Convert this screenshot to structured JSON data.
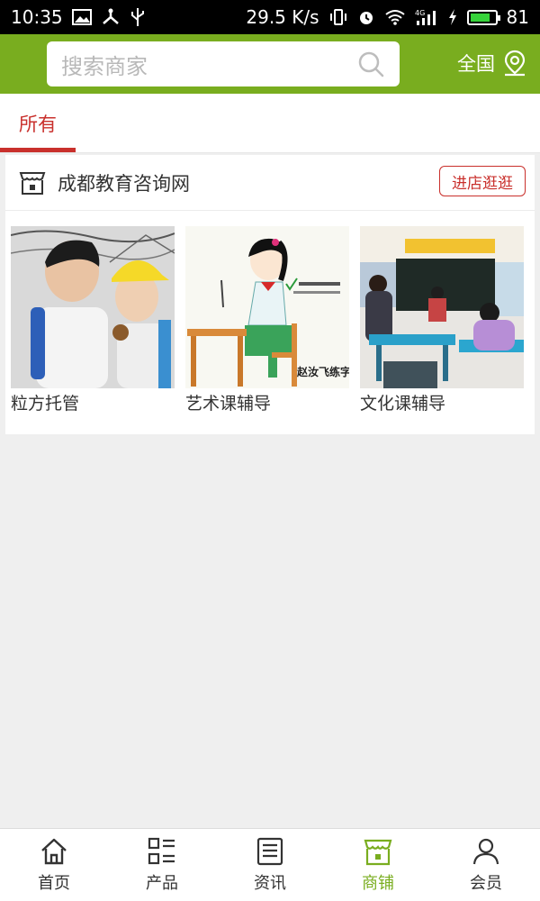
{
  "status_bar": {
    "time": "10:35",
    "speed": "29.5 K/s",
    "network_label": "4G",
    "battery": "81",
    "battery_level": 0.81
  },
  "header": {
    "search_placeholder": "搜索商家",
    "region_label": "全国"
  },
  "tabs": [
    {
      "label": "所有",
      "active": true
    }
  ],
  "shop": {
    "name": "成都教育咨询网",
    "enter_button": "进店逛逛",
    "products": [
      {
        "name": "粒方托管",
        "image": "children-photo"
      },
      {
        "name": "艺术课辅导",
        "image": "writing-posture-illustration",
        "image_caption": "赵汝飞练字"
      },
      {
        "name": "文化课辅导",
        "image": "classroom-photo"
      }
    ]
  },
  "bottom_nav": [
    {
      "label": "首页",
      "icon": "home-icon",
      "active": false
    },
    {
      "label": "产品",
      "icon": "grid-list-icon",
      "active": false
    },
    {
      "label": "资讯",
      "icon": "news-icon",
      "active": false
    },
    {
      "label": "商铺",
      "icon": "store-icon",
      "active": true
    },
    {
      "label": "会员",
      "icon": "user-icon",
      "active": false
    }
  ],
  "colors": {
    "brand_green": "#79ad1f",
    "accent_red": "#c9302c",
    "page_background": "#efefef"
  }
}
